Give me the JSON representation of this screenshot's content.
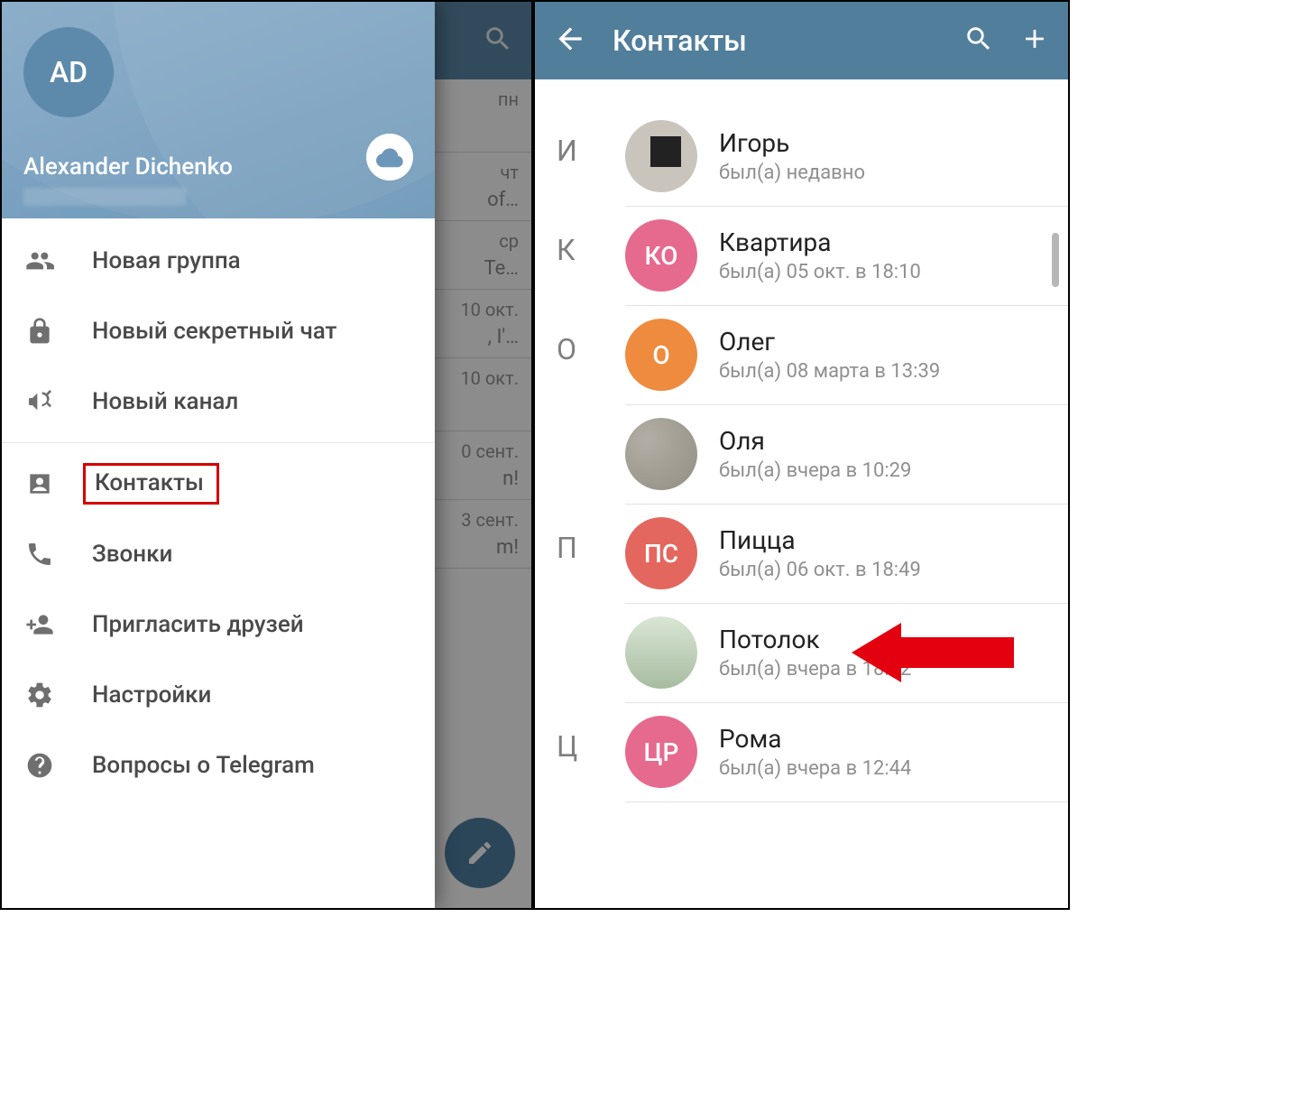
{
  "left": {
    "profile": {
      "initials": "AD",
      "name": "Alexander Dichenko"
    },
    "search_icon": "search",
    "menu": [
      {
        "icon": "group",
        "label": "Новая группа"
      },
      {
        "icon": "lock",
        "label": "Новый секретный чат"
      },
      {
        "icon": "megaphone",
        "label": "Новый канал"
      },
      {
        "icon": "contact",
        "label": "Контакты",
        "highlighted": true
      },
      {
        "icon": "phone",
        "label": "Звонки"
      },
      {
        "icon": "invite",
        "label": "Пригласить друзей"
      },
      {
        "icon": "settings",
        "label": "Настройки"
      },
      {
        "icon": "help",
        "label": "Вопросы о Telegram"
      }
    ],
    "chatlist_bg": [
      {
        "date": "пн",
        "snip": ""
      },
      {
        "date": "чт",
        "snip": "of…"
      },
      {
        "date": "ср",
        "snip": "Te…"
      },
      {
        "date": "10 окт.",
        "snip": ", I'…"
      },
      {
        "date": "10 окт.",
        "snip": ""
      },
      {
        "date": "0 сент.",
        "snip": "n!"
      },
      {
        "date": "3 сент.",
        "snip": "m!"
      }
    ]
  },
  "right": {
    "title": "Контакты",
    "sections": [
      {
        "letter": "И",
        "contacts": [
          {
            "name": "Игорь",
            "status": "был(а) недавно",
            "avatar_type": "photo"
          }
        ]
      },
      {
        "letter": "К",
        "contacts": [
          {
            "name": "Квартира",
            "status": "был(а) 05 окт. в 18:10",
            "avatar_type": "initials",
            "initials": "КО",
            "color": "#e66a8e"
          }
        ]
      },
      {
        "letter": "О",
        "contacts": [
          {
            "name": "Олег",
            "status": "был(а) 08 марта в 13:39",
            "avatar_type": "initials",
            "initials": "О",
            "color": "#ee8b3e"
          },
          {
            "name": "Оля",
            "status": "был(а) вчера в 10:29",
            "avatar_type": "photo2"
          }
        ]
      },
      {
        "letter": "П",
        "contacts": [
          {
            "name": "Пицца",
            "status": "был(а) 06 окт. в 18:49",
            "avatar_type": "initials",
            "initials": "ПС",
            "color": "#e3675e"
          },
          {
            "name": "Потолок",
            "status": "был(а) вчера в 18:02",
            "avatar_type": "photo3",
            "arrow": true
          }
        ]
      },
      {
        "letter": "Ц",
        "contacts": [
          {
            "name": "Рома",
            "status": "был(а) вчера в 12:44",
            "avatar_type": "initials",
            "initials": "ЦР",
            "color": "#e66a8e"
          }
        ]
      }
    ]
  }
}
